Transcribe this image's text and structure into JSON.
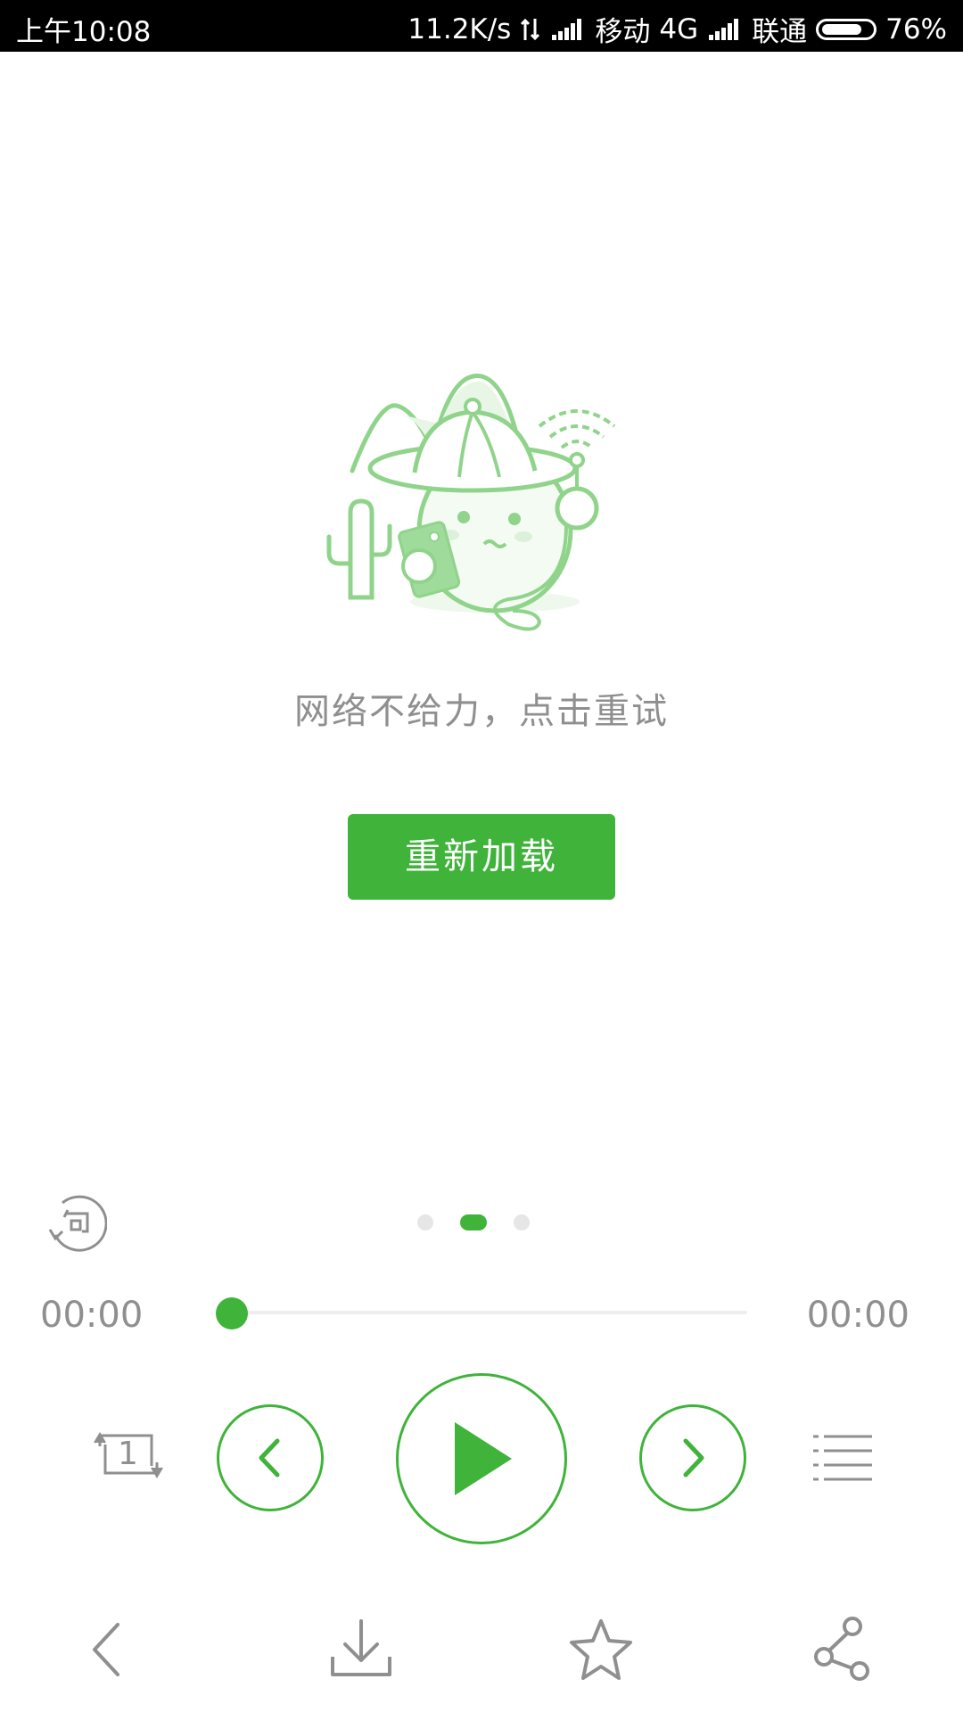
{
  "status_bar": {
    "time": "上午10:08",
    "speed": "11.2K/s",
    "carrier1": "移动",
    "network": "4G",
    "carrier2": "联通",
    "battery": "76%"
  },
  "error": {
    "message": "网络不给力，点击重试",
    "reload_label": "重新加载",
    "accent_color": "#3fb33a"
  },
  "player": {
    "current_time": "00:00",
    "total_time": "00:00",
    "progress": 0,
    "page_indicator": {
      "count": 3,
      "active": 2
    },
    "repeat_mode_number": "1"
  },
  "icons": {
    "lyric": "lyric-icon",
    "repeat_one": "repeat-one-icon",
    "previous": "previous-icon",
    "play": "play-icon",
    "next": "next-icon",
    "playlist": "playlist-icon",
    "back": "back-icon",
    "download": "download-icon",
    "favorite": "star-icon",
    "share": "share-icon"
  }
}
